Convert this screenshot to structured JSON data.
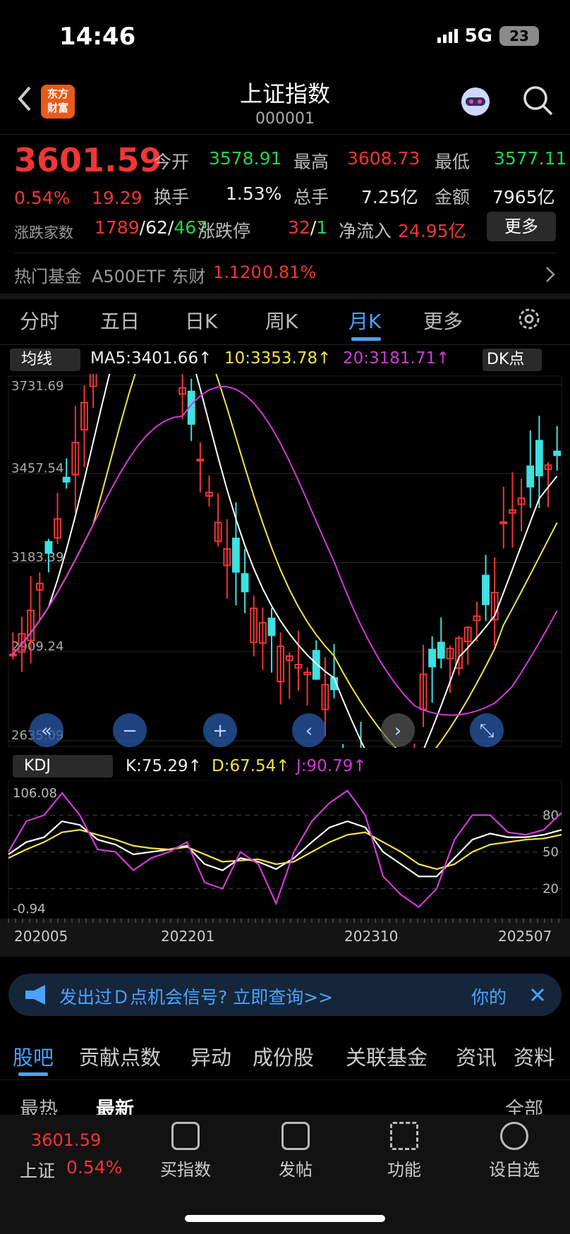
{
  "status": {
    "time": "14:46",
    "network": "5G",
    "battery": "23"
  },
  "header": {
    "title": "上证指数",
    "code": "000001",
    "logo_line1": "东方",
    "logo_line2": "财富"
  },
  "quote": {
    "price": "3601.59",
    "change_pct": "0.54%",
    "change": "19.29",
    "open_label": "今开",
    "open": "3578.91",
    "high_label": "最高",
    "high": "3608.73",
    "low_label": "最低",
    "low": "3577.11",
    "turnover_label": "换手",
    "turnover": "1.53%",
    "volume_label": "总手",
    "volume": "7.25亿",
    "amount_label": "金额",
    "amount": "7965亿",
    "adv_dec_label": "涨跌家数",
    "adv": "1789",
    "flat": "62",
    "dec": "467",
    "limit_label": "涨跌停",
    "limit_up": "32",
    "limit_down": "1",
    "netflow_label": "净流入",
    "netflow": "24.95亿",
    "more": "更多"
  },
  "hot_fund": {
    "label": "热门基金",
    "name": "A500ETF 东财",
    "price": "1.120",
    "pct": "0.81%"
  },
  "tabs": [
    "分时",
    "五日",
    "日K",
    "周K",
    "月K",
    "更多"
  ],
  "active_tab": 4,
  "ma": {
    "select": "均线",
    "ma5": "MA5:3401.66↑",
    "ma10": "10:3353.78↑",
    "ma20": "20:3181.71↑",
    "dk": "DK点"
  },
  "kdj": {
    "select": "KDJ",
    "k": "K:75.29↑",
    "d": "D:67.54↑",
    "j": "J:90.79↑"
  },
  "chart_data": [
    {
      "type": "candlestick",
      "title": "",
      "ylim": [
        2635.09,
        3731.69
      ],
      "y_ticks": [
        "3731.69",
        "3457.54",
        "3183.39",
        "2909.24",
        "2635.09"
      ],
      "ma_series": [
        {
          "name": "MA5",
          "color": "#ffffff"
        },
        {
          "name": "10",
          "color": "#f2e34a"
        },
        {
          "name": "20",
          "color": "#d23ad6"
        }
      ]
    },
    {
      "type": "line",
      "title": "",
      "ylim": [
        -0.94,
        106.08
      ],
      "y_ticks": [
        "106.08",
        "-0.94"
      ],
      "right_ticks": [
        "80",
        "50",
        "20"
      ],
      "x_ticks": [
        "202005",
        "202201",
        "202310",
        "202507"
      ],
      "series": [
        {
          "name": "K",
          "color": "#ffffff",
          "values": [
            48,
            58,
            62,
            75,
            72,
            60,
            56,
            48,
            50,
            52,
            55,
            40,
            35,
            45,
            42,
            36,
            45,
            58,
            70,
            75,
            70,
            50,
            40,
            30,
            30,
            45,
            60,
            65,
            62,
            62,
            64,
            68
          ]
        },
        {
          "name": "D",
          "color": "#f2e34a",
          "values": [
            45,
            52,
            58,
            66,
            68,
            64,
            60,
            55,
            53,
            52,
            54,
            48,
            42,
            43,
            44,
            40,
            42,
            50,
            58,
            64,
            66,
            58,
            50,
            40,
            36,
            40,
            50,
            56,
            58,
            60,
            61,
            64
          ]
        },
        {
          "name": "J",
          "color": "#d23ad6",
          "values": [
            50,
            75,
            80,
            98,
            80,
            52,
            50,
            35,
            45,
            50,
            58,
            25,
            20,
            50,
            40,
            8,
            50,
            75,
            90,
            100,
            80,
            30,
            15,
            5,
            20,
            60,
            80,
            80,
            66,
            64,
            68,
            82
          ]
        }
      ]
    }
  ],
  "banner": {
    "text": "发出过Ｄ点机会信号? 立即查询>>",
    "right": "你的"
  },
  "bottom_tabs": [
    "股吧",
    "贡献点数",
    "异动",
    "成份股",
    "关联基金",
    "资讯",
    "资料"
  ],
  "sort": {
    "hot": "最热",
    "new": "最新",
    "all": "全部"
  },
  "nav": {
    "index_price": "3601.59",
    "index_name": "上证",
    "index_pct": "0.54%",
    "buy": "买指数",
    "post": "发帖",
    "func": "功能",
    "watch": "设自选"
  }
}
